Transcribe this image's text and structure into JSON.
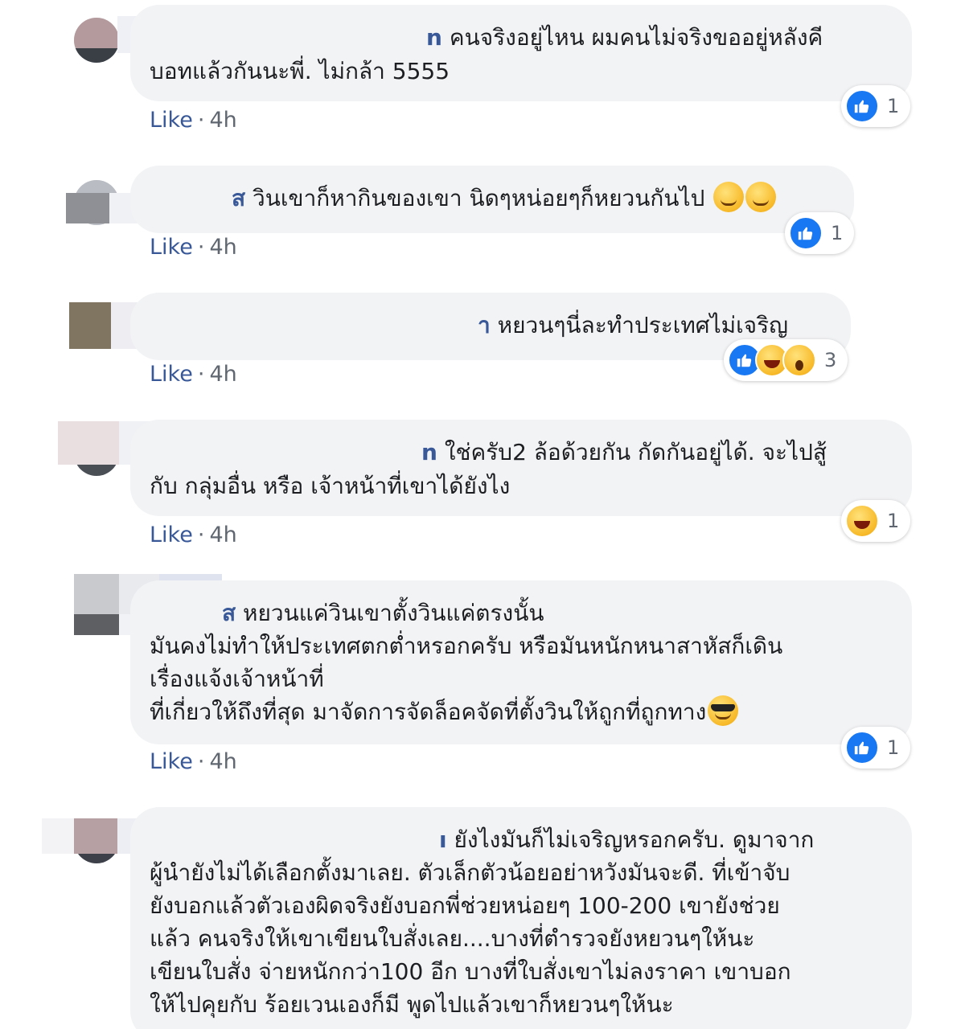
{
  "comments": [
    {
      "name_tail": "n",
      "lines": [
        "คนจริงอยู่ไหน ผมคนไม่จริงขออยู่หลังคี",
        "บอทแล้วกันนะพี่. ไม่กล้า 5555"
      ],
      "reactions": [
        "like"
      ],
      "reaction_count": "1",
      "like_label": "Like",
      "time": "4h"
    },
    {
      "name_tail": "ส",
      "lines": [
        "วินเขาก็หากินของเขา นิดๆหน่อยๆก็หยวนกันไป"
      ],
      "trailing_emoji": [
        "smirk-face",
        "smirk-face"
      ],
      "reactions": [
        "like"
      ],
      "reaction_count": "1",
      "like_label": "Like",
      "time": "4h"
    },
    {
      "name_tail": "า",
      "lines": [
        "หยวนๆนี่ละทำประเทศไม่เจริญ"
      ],
      "reactions": [
        "like",
        "haha",
        "wow"
      ],
      "reaction_count": "3",
      "like_label": "Like",
      "time": "4h"
    },
    {
      "name_tail": "n",
      "lines": [
        "ใช่ครับ2 ล้อด้วยกัน กัดกันอยู่ได้. จะไปสู้",
        "กับ กลุ่มอื่น หรือ เจ้าหน้าที่เขาได้ยังไง"
      ],
      "reactions": [
        "haha"
      ],
      "reaction_count": "1",
      "like_label": "Like",
      "time": "4h"
    },
    {
      "name_tail": "ส",
      "lines": [
        "หยวนแค่วินเขาตั้งวินแค่ตรงนั้น",
        "มันคงไม่ทำให้ประเทศตกต่ำหรอกครับ หรือมันหนักหนาสาหัสก็เดิน",
        "เรื่องแจ้งเจ้าหน้าที่",
        "ที่เกี่ยวให้ถึงที่สุด มาจัดการจัดล็อคจัดที่ตั้งวินให้ถูกที่ถูกทาง"
      ],
      "trailing_emoji": [
        "cool-face"
      ],
      "reactions": [
        "like"
      ],
      "reaction_count": "1",
      "like_label": "Like",
      "time": "4h"
    },
    {
      "name_tail": "ı",
      "lines": [
        "ยังไงมันก็ไม่เจริญหรอกครับ. ดูมาจาก",
        "ผู้นำยังไม่ได้เลือกตั้งมาเลย. ตัวเล็กตัวน้อยอย่าหวังมันจะดี. ที่เข้าจับ",
        "ยังบอกแล้วตัวเองผิดจริงยังบอกพี่ช่วยหน่อยๆ 100-200 เขายังช่วย",
        "แล้ว คนจริงให้เขาเขียนใบสั่งเลย....บางที่ตำรวจยังหยวนๆให้นะ",
        "เขียนใบสั่ง จ่ายหนักกว่า100 อีก บางที่ใบสั่งเขาไม่ลงราคา เขาบอก",
        "ให้ไปคุยกับ ร้อยเวนเองก็มี พูดไปแล้วเขาก็หยวนๆให้นะ"
      ]
    }
  ]
}
